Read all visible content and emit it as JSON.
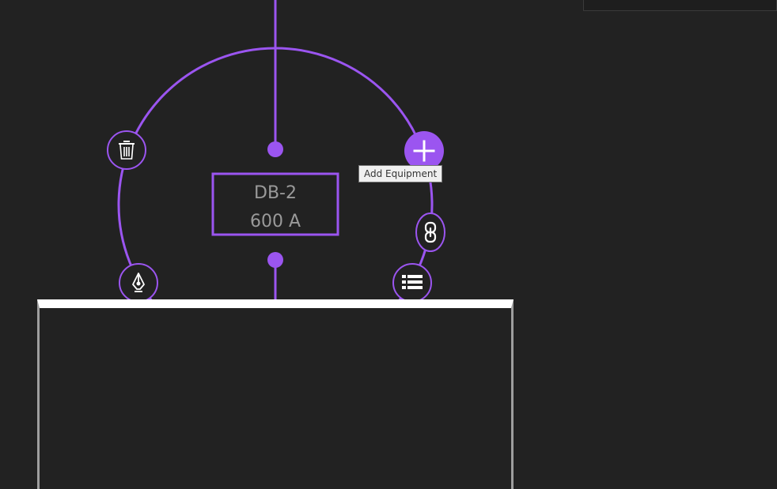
{
  "node": {
    "name": "DB-2",
    "rating": "600 A"
  },
  "tooltip": {
    "text": "Add Equipment"
  },
  "actions": {
    "delete": "trash-icon",
    "add": "plus-icon",
    "link": "link-icon",
    "edit": "pen-icon",
    "list": "list-icon"
  },
  "colors": {
    "background": "#222222",
    "accent": "#9b55f0",
    "label": "#9a9a9a",
    "panel_border": "#9e9e9e",
    "panel_header": "#ffffff"
  }
}
